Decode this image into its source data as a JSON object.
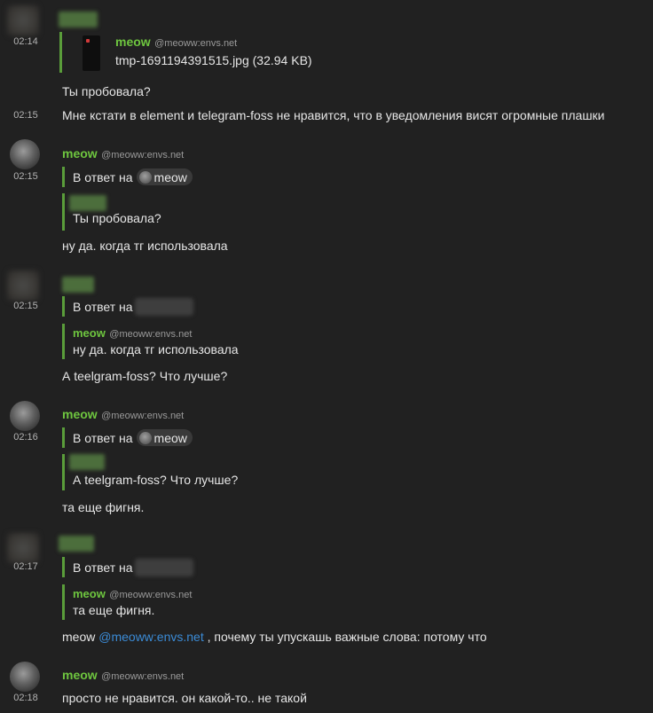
{
  "messages": [
    {
      "time": "02:14",
      "sender": "",
      "quote_sender": "meow",
      "quote_handle": "@meoww:envs.net",
      "file_name": "tmp-1691194391515.jpg (32.94 KB)"
    },
    {
      "text": "Ты пробовала?"
    },
    {
      "time": "02:15",
      "text": "Мне кстати в element и telegram-foss не нравится, что в уведомления висят огромные плашки"
    },
    {
      "time": "02:15",
      "sender": "meow",
      "handle": "@meoww:envs.net",
      "reply_prefix": "В ответ на",
      "reply_pill": "meow",
      "quote_text": "Ты пробовала?",
      "text": "ну да. когда тг использовала"
    },
    {
      "time": "02:15",
      "reply_prefix": "В ответ на",
      "quote_sender": "meow",
      "quote_handle": "@meoww:envs.net",
      "quote_text": "ну да. когда тг использовала",
      "text": "А teelgram-foss? Что лучше?"
    },
    {
      "time": "02:16",
      "sender": "meow",
      "handle": "@meoww:envs.net",
      "reply_prefix": "В ответ на",
      "reply_pill": "meow",
      "quote_text": "А teelgram-foss? Что лучше?",
      "text": "та еще фигня."
    },
    {
      "time": "02:17",
      "reply_prefix": "В ответ на",
      "quote_sender": "meow",
      "quote_handle": "@meoww:envs.net",
      "quote_text": "та еще фигня.",
      "text_before": "meow",
      "mention": "@meoww:envs.net",
      "text_after": ", почему ты упускашь важные слова: потому что"
    },
    {
      "time": "02:18",
      "sender": "meow",
      "handle": "@meoww:envs.net",
      "text": "просто не нравится. он какой-то.. не такой"
    }
  ]
}
